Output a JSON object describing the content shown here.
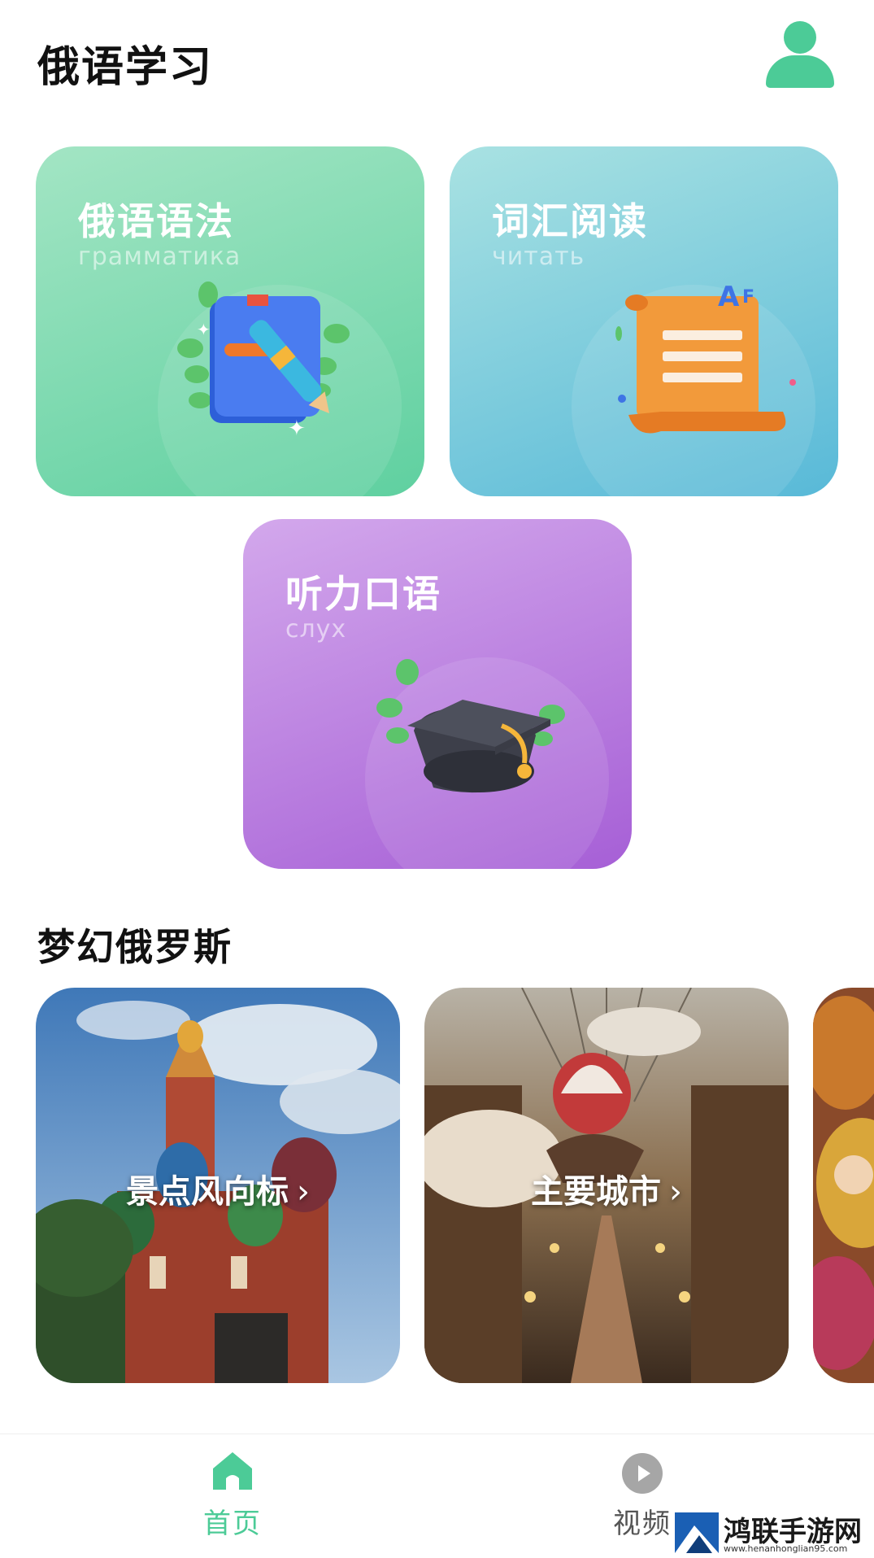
{
  "colors": {
    "accent": "#4ccb97",
    "grammar_card": "#6fd6a8",
    "vocab_card": "#66c3db",
    "listening_card": "#b47ddd"
  },
  "header": {
    "title": "俄语学习",
    "profile_icon": "user-icon"
  },
  "cards": [
    {
      "title": "俄语语法",
      "subtitle": "грамматика",
      "icon": "book-pen-icon"
    },
    {
      "title": "词汇阅读",
      "subtitle": "читать",
      "icon": "scroll-icon"
    },
    {
      "title": "听力口语",
      "subtitle": "слух",
      "icon": "graduation-cap-icon"
    }
  ],
  "section": {
    "title": "梦幻俄罗斯"
  },
  "destinations": [
    {
      "label": "景点风向标",
      "chevron": "›"
    },
    {
      "label": "主要城市",
      "chevron": "›"
    }
  ],
  "tabbar": {
    "items": [
      {
        "label": "首页",
        "icon": "home-icon",
        "active": true
      },
      {
        "label": "视频",
        "icon": "play-icon",
        "active": false
      }
    ]
  },
  "watermark": {
    "name": "鸿联手游网",
    "url": "www.henanhonglian95.com"
  }
}
